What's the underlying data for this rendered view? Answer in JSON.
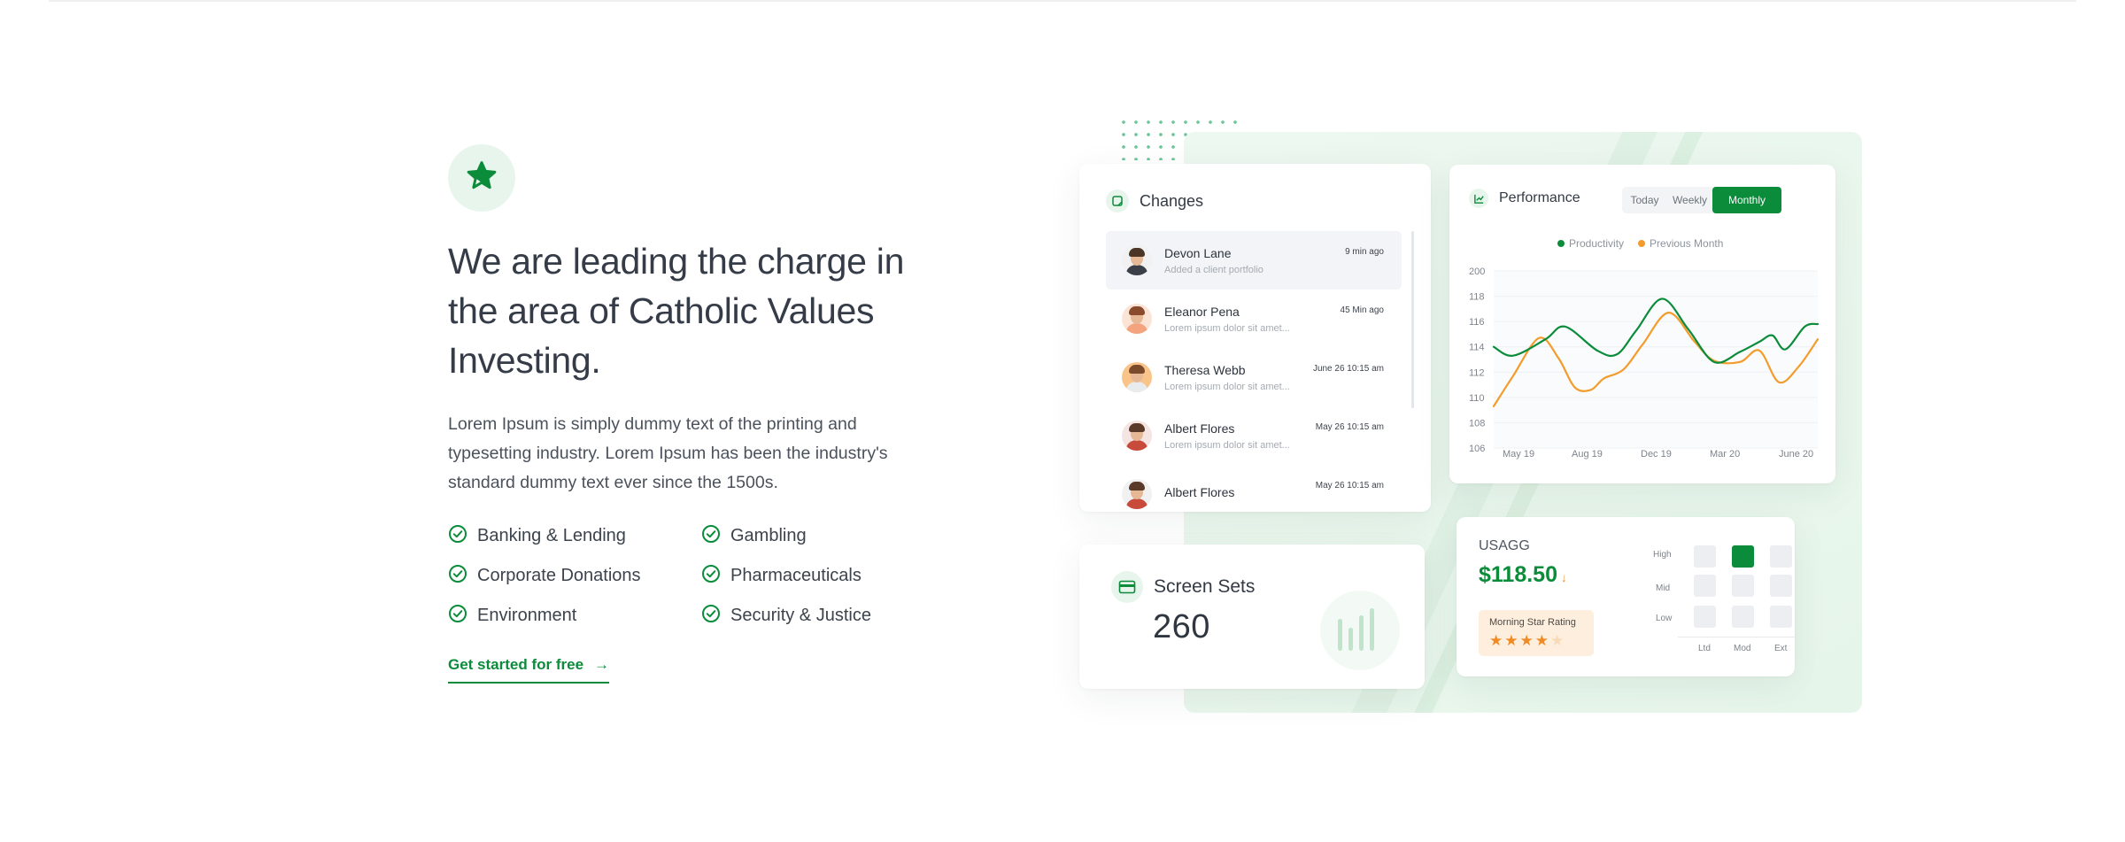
{
  "hero": {
    "badge_icon": "star-icon",
    "title": "We are leading the charge in the area of Catholic Values Investing.",
    "lead": "Lorem Ipsum is simply dummy text of the printing and typesetting industry. Lorem Ipsum has been the industry's standard dummy text ever since the 1500s.",
    "features": [
      "Banking & Lending",
      "Gambling",
      "Corporate Donations",
      "Pharmaceuticals",
      "Environment",
      "Security & Justice"
    ],
    "cta_label": "Get started for free",
    "cta_arrow": "→"
  },
  "changes": {
    "title": "Changes",
    "items": [
      {
        "name": "Devon Lane",
        "sub": "Added a client portfolio",
        "time": "9 min ago"
      },
      {
        "name": "Eleanor Pena",
        "sub": "Lorem ipsum dolor sit amet...",
        "time": "45 Min ago"
      },
      {
        "name": "Theresa Webb",
        "sub": "Lorem ipsum dolor sit amet...",
        "time": "June 26 10:15 am"
      },
      {
        "name": "Albert Flores",
        "sub": "Lorem ipsum dolor sit amet...",
        "time": "May 26 10:15 am"
      },
      {
        "name": "Albert Flores",
        "sub": "",
        "time": "May 26 10:15 am"
      }
    ]
  },
  "performance": {
    "title": "Performance",
    "tabs": [
      "Today",
      "Weekly",
      "Monthly"
    ],
    "active_tab": "Monthly"
  },
  "screen_sets": {
    "title": "Screen Sets",
    "count": "260"
  },
  "usagg": {
    "ticker": "USAGG",
    "price": "$118.50",
    "trend": "↓",
    "rating_label": "Morning Star Rating",
    "rating_value": 4,
    "rating_max": 5,
    "rows": [
      "High",
      "Mid",
      "Low"
    ],
    "cols": [
      "Ltd",
      "Mod",
      "Ext"
    ],
    "selected": {
      "row": "High",
      "col": "Mod"
    }
  },
  "colors": {
    "accent": "#0b8c3b",
    "secondary": "#f39c2b",
    "grid_cell": "#eceef2"
  },
  "chart_data": {
    "type": "line",
    "x": [
      "May 19",
      "Aug 19",
      "Dec 19",
      "Mar 20",
      "June 20"
    ],
    "y_ticks": [
      106,
      108,
      110,
      112,
      114,
      116,
      118,
      200
    ],
    "ylim": [
      106,
      120
    ],
    "series": [
      {
        "name": "Productivity",
        "color": "#0b8c3b",
        "points": [
          [
            0,
            114
          ],
          [
            0.3,
            113.3
          ],
          [
            0.8,
            114.6
          ],
          [
            1.1,
            115.6
          ],
          [
            1.6,
            113.7
          ],
          [
            1.9,
            113.4
          ],
          [
            2.2,
            115.3
          ],
          [
            2.6,
            117.8
          ],
          [
            3.0,
            115.4
          ],
          [
            3.4,
            112.8
          ],
          [
            3.8,
            113.6
          ],
          [
            4.1,
            114.4
          ],
          [
            4.3,
            114.9
          ],
          [
            4.5,
            113.8
          ],
          [
            4.8,
            115.6
          ],
          [
            5.0,
            115.8
          ]
        ]
      },
      {
        "name": "Previous Month",
        "color": "#f39c2b",
        "points": [
          [
            0,
            109.3
          ],
          [
            0.3,
            111.7
          ],
          [
            0.7,
            114.7
          ],
          [
            1.0,
            113.1
          ],
          [
            1.25,
            110.8
          ],
          [
            1.5,
            110.6
          ],
          [
            1.7,
            111.5
          ],
          [
            2.0,
            112.2
          ],
          [
            2.3,
            114.2
          ],
          [
            2.7,
            116.7
          ],
          [
            3.1,
            114.4
          ],
          [
            3.4,
            112.9
          ],
          [
            3.8,
            112.8
          ],
          [
            4.1,
            113.7
          ],
          [
            4.4,
            111.2
          ],
          [
            4.7,
            112.4
          ],
          [
            5.0,
            114.6
          ]
        ]
      }
    ],
    "legend": "top",
    "grid": true
  }
}
